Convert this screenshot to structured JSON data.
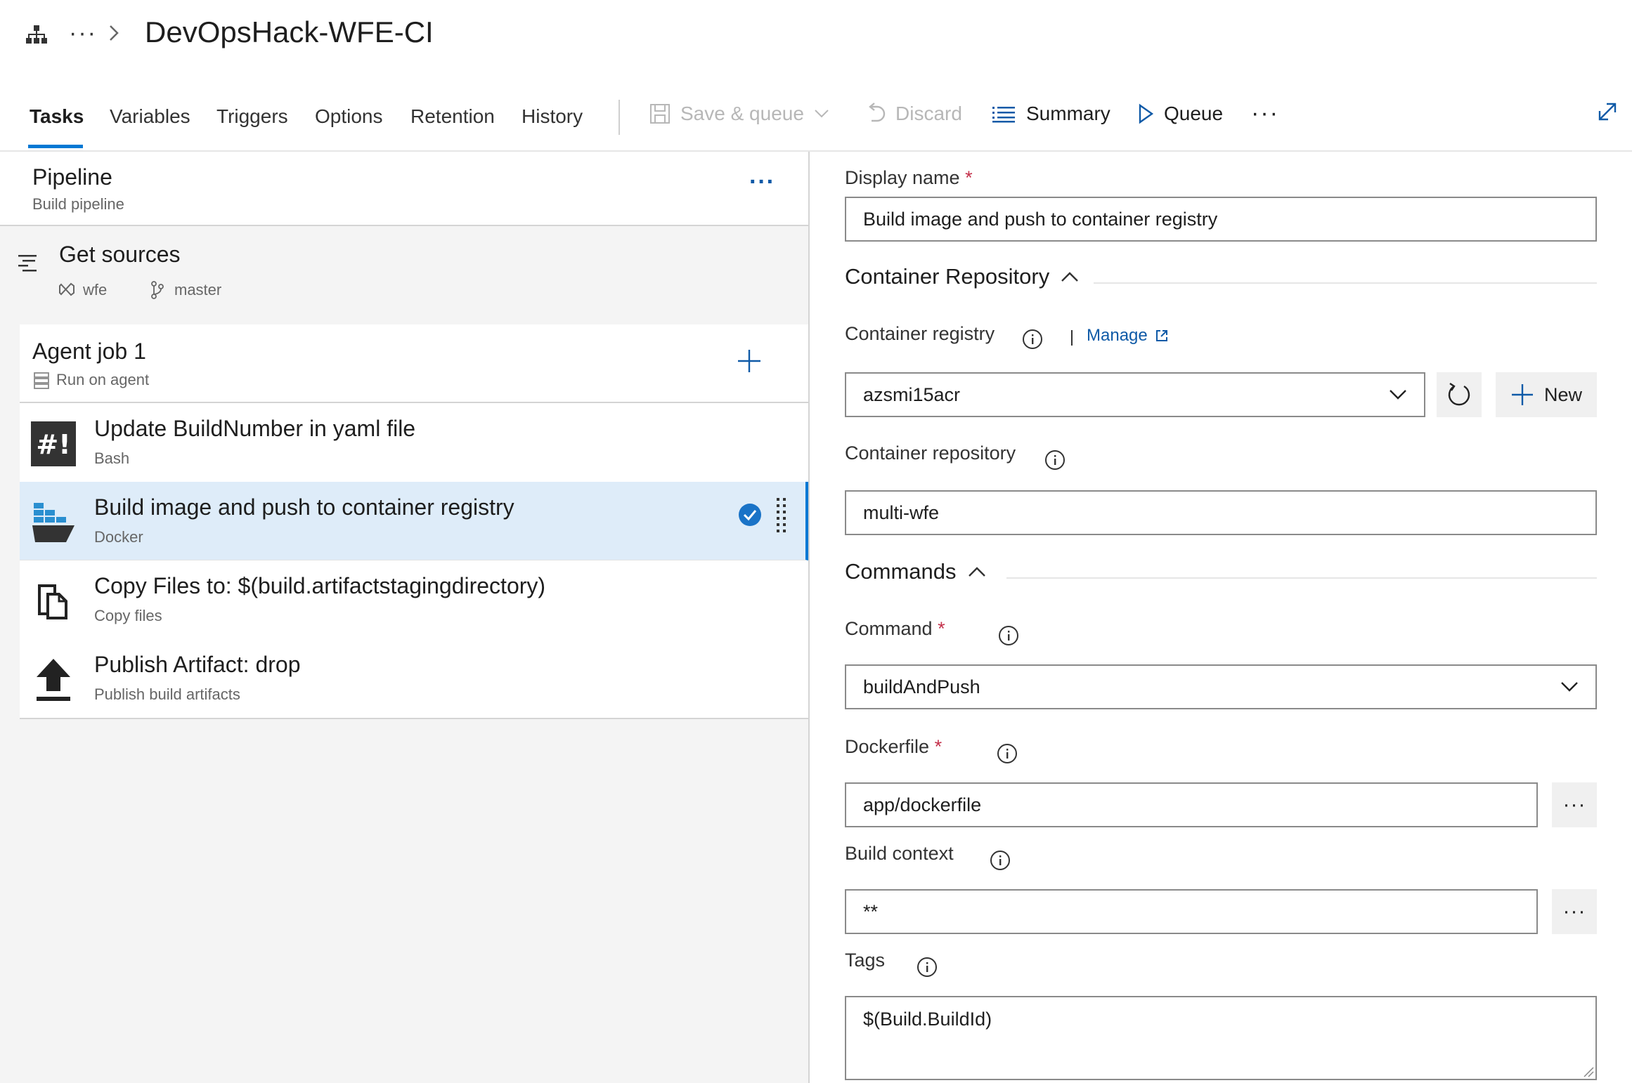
{
  "header": {
    "ellipsis": "···",
    "title": "DevOpsHack-WFE-CI"
  },
  "tabs": [
    "Tasks",
    "Variables",
    "Triggers",
    "Options",
    "Retention",
    "History"
  ],
  "toolbar": {
    "save_queue": "Save & queue",
    "discard": "Discard",
    "summary": "Summary",
    "queue": "Queue",
    "more": "···"
  },
  "pipeline": {
    "title": "Pipeline",
    "subtitle": "Build pipeline",
    "menu": "···"
  },
  "get_sources": {
    "title": "Get sources",
    "repo": "wfe",
    "branch": "master"
  },
  "agent_job": {
    "title": "Agent job 1",
    "subtitle": "Run on agent"
  },
  "tasks": [
    {
      "title": "Update BuildNumber in yaml file",
      "subtitle": "Bash",
      "icon": "bash-icon",
      "selected": false
    },
    {
      "title": "Build image and push to container registry",
      "subtitle": "Docker",
      "icon": "docker-icon",
      "selected": true
    },
    {
      "title": "Copy Files to: $(build.artifactstagingdirectory)",
      "subtitle": "Copy files",
      "icon": "copy-files-icon",
      "selected": false
    },
    {
      "title": "Publish Artifact: drop",
      "subtitle": "Publish build artifacts",
      "icon": "publish-artifact-icon",
      "selected": false
    }
  ],
  "form": {
    "display_name": {
      "label": "Display name",
      "required": "*",
      "value": "Build image and push to container registry"
    },
    "section_repo": "Container Repository",
    "container_registry": {
      "label": "Container registry",
      "manage": "Manage",
      "value": "azsmi15acr",
      "new": "New"
    },
    "container_repository": {
      "label": "Container repository",
      "value": "multi-wfe"
    },
    "section_commands": "Commands",
    "command": {
      "label": "Command",
      "required": "*",
      "value": "buildAndPush"
    },
    "dockerfile": {
      "label": "Dockerfile",
      "required": "*",
      "value": "app/dockerfile",
      "browse": "···"
    },
    "build_context": {
      "label": "Build context",
      "value": "**",
      "browse": "···"
    },
    "tags": {
      "label": "Tags",
      "value": "$(Build.BuildId)"
    }
  },
  "colors": {
    "accent": "#0078d4",
    "link": "#0f5aa7",
    "required": "#c4314b",
    "selected_row": "#deecf9"
  }
}
